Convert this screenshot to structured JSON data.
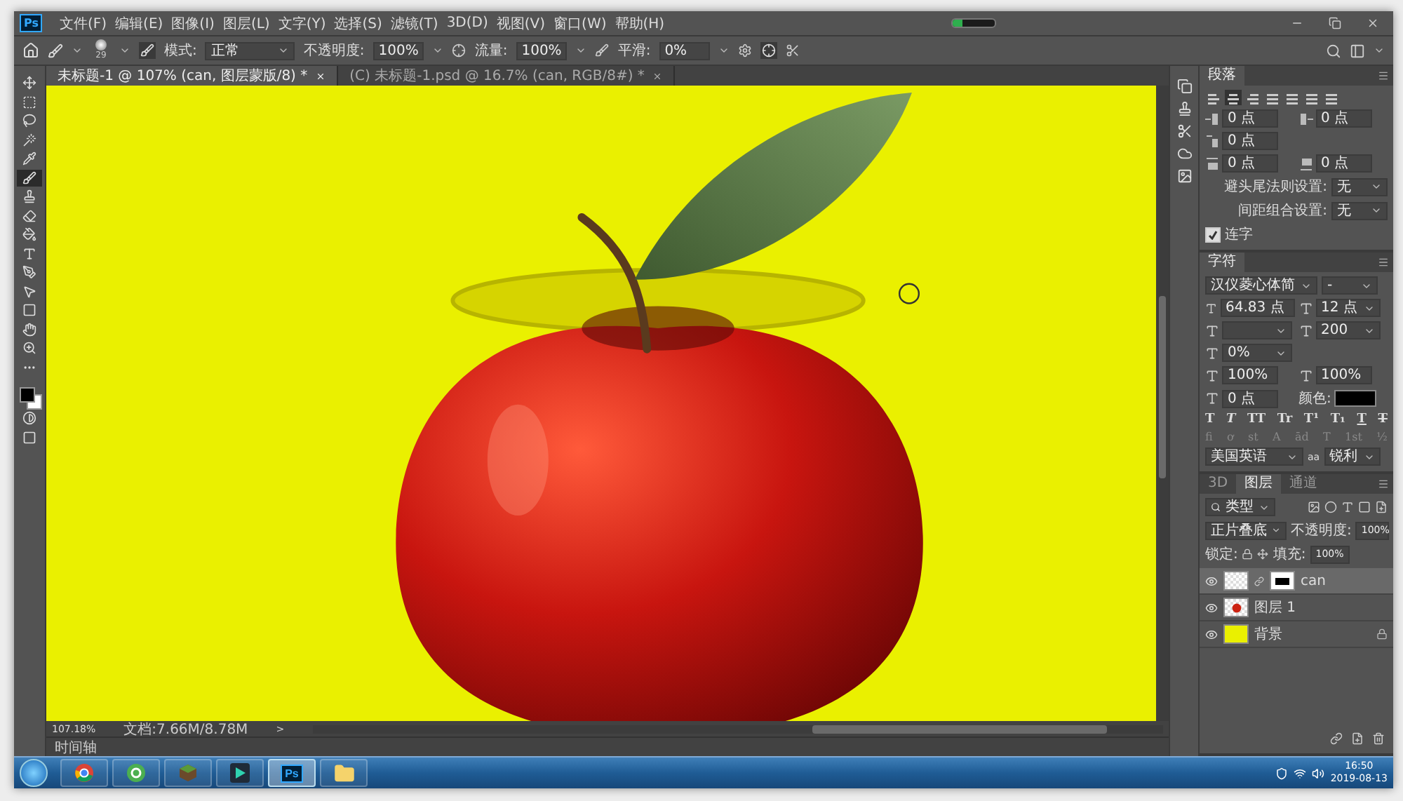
{
  "menu_bar": {
    "logo": "Ps",
    "items": [
      "文件(F)",
      "编辑(E)",
      "图像(I)",
      "图层(L)",
      "文字(Y)",
      "选择(S)",
      "滤镜(T)",
      "3D(D)",
      "视图(V)",
      "窗口(W)",
      "帮助(H)"
    ],
    "progress": {
      "level": 0.25
    }
  },
  "options_bar": {
    "brush_size": "29",
    "mode_label": "模式:",
    "mode": "正常",
    "opacity_label": "不透明度:",
    "opacity": "100%",
    "flow_label": "流量:",
    "flow": "100%",
    "smoothing_label": "平滑:",
    "smoothing": "0%"
  },
  "tools": [
    {
      "kind": "move",
      "selected": false
    },
    {
      "kind": "marquee",
      "selected": false
    },
    {
      "kind": "lasso",
      "selected": false
    },
    {
      "kind": "wand",
      "selected": false
    },
    {
      "kind": "eyedropper",
      "selected": false
    },
    {
      "kind": "brush",
      "selected": true
    },
    {
      "kind": "stamp",
      "selected": false
    },
    {
      "kind": "eraser",
      "selected": false
    },
    {
      "kind": "bucket",
      "selected": false
    },
    {
      "kind": "type",
      "selected": false
    },
    {
      "kind": "pen",
      "selected": false
    },
    {
      "kind": "pointer",
      "selected": false
    },
    {
      "kind": "shape",
      "selected": false
    },
    {
      "kind": "hand",
      "selected": false
    },
    {
      "kind": "zoom",
      "selected": false
    },
    {
      "kind": "more",
      "selected": false
    }
  ],
  "tabs": [
    {
      "label": "未标题-1 @ 107% (can, 图层蒙版/8) *",
      "selected": true
    },
    {
      "label": "(C) 未标题-1.psd @ 16.7% (can, RGB/8#) *",
      "selected": false
    }
  ],
  "status_bar": {
    "zoom": "107.18%",
    "document": "文档:7.66M/8.78M",
    "arrow": ">"
  },
  "timeline": "时间轴",
  "paragraph_panel": {
    "title": "段落",
    "align_buttons": [
      {
        "selected": false
      },
      {
        "selected": true
      },
      {
        "selected": false
      },
      {
        "selected": false
      },
      {
        "selected": false
      },
      {
        "selected": false
      },
      {
        "selected": false
      }
    ],
    "indents": [
      {
        "kind": "left",
        "value": "0 点"
      },
      {
        "kind": "right",
        "value": "0 点"
      },
      {
        "kind": "first",
        "value": "0 点"
      },
      {
        "kind": "before",
        "value": "0 点"
      },
      {
        "kind": "after",
        "value": "0 点"
      }
    ],
    "kinsoku_label": "避头尾法则设置:",
    "kinsoku": "无",
    "mojikumi_label": "间距组合设置:",
    "mojikumi": "无",
    "hyphenate": {
      "label": "连字",
      "checked": true
    }
  },
  "character_panel": {
    "title": "字符",
    "font": "汉仪菱心体简",
    "style": "-",
    "size": "64.83 点",
    "leading": "12 点",
    "tracking": "200",
    "tsume": "0%",
    "vertical_scale": "100%",
    "horizontal_scale": "100%",
    "baseline": "0 点",
    "color_label": "颜色:",
    "type_styles": [
      {
        "kind": "bold",
        "label": "T"
      },
      {
        "kind": "italic",
        "label": "T"
      },
      {
        "kind": "caps",
        "label": "TT"
      },
      {
        "kind": "smallcaps",
        "label": "Tr"
      },
      {
        "kind": "super",
        "label": "T¹"
      },
      {
        "kind": "sub",
        "label": "T₁"
      },
      {
        "kind": "underline",
        "label": "T"
      },
      {
        "kind": "strike",
        "label": "T"
      }
    ],
    "opentype": [
      "fi",
      "ơ",
      "st",
      "A",
      "ād",
      "T",
      "1st",
      "½"
    ],
    "language": "美国英语",
    "aa_label": "aa",
    "aa": "锐利"
  },
  "layers_panel": {
    "tabs": [
      {
        "label": "3D",
        "selected": false
      },
      {
        "label": "图层",
        "selected": true
      },
      {
        "label": "通道",
        "selected": false
      }
    ],
    "filter": "类型",
    "blend": "正片叠底",
    "opacity_label": "不透明度:",
    "opacity": "100%",
    "lock_label": "锁定:",
    "fill_label": "填充:",
    "fill": "100%",
    "layers": [
      {
        "name": "can",
        "kind": "masked",
        "selected": true,
        "locked": false
      },
      {
        "name": "图层 1",
        "kind": "image",
        "selected": false,
        "locked": false
      },
      {
        "name": "背景",
        "kind": "fill",
        "selected": false,
        "locked": true
      }
    ]
  },
  "taskbar": {
    "apps": [
      {
        "kind": "browser",
        "selected": false
      },
      {
        "kind": "globe",
        "selected": false
      },
      {
        "kind": "cube",
        "selected": false
      },
      {
        "kind": "video",
        "selected": false
      },
      {
        "kind": "photoshop",
        "label": "Ps",
        "selected": true
      },
      {
        "kind": "folder",
        "selected": false
      }
    ],
    "time": "16:50",
    "date": "2019-08-13"
  }
}
